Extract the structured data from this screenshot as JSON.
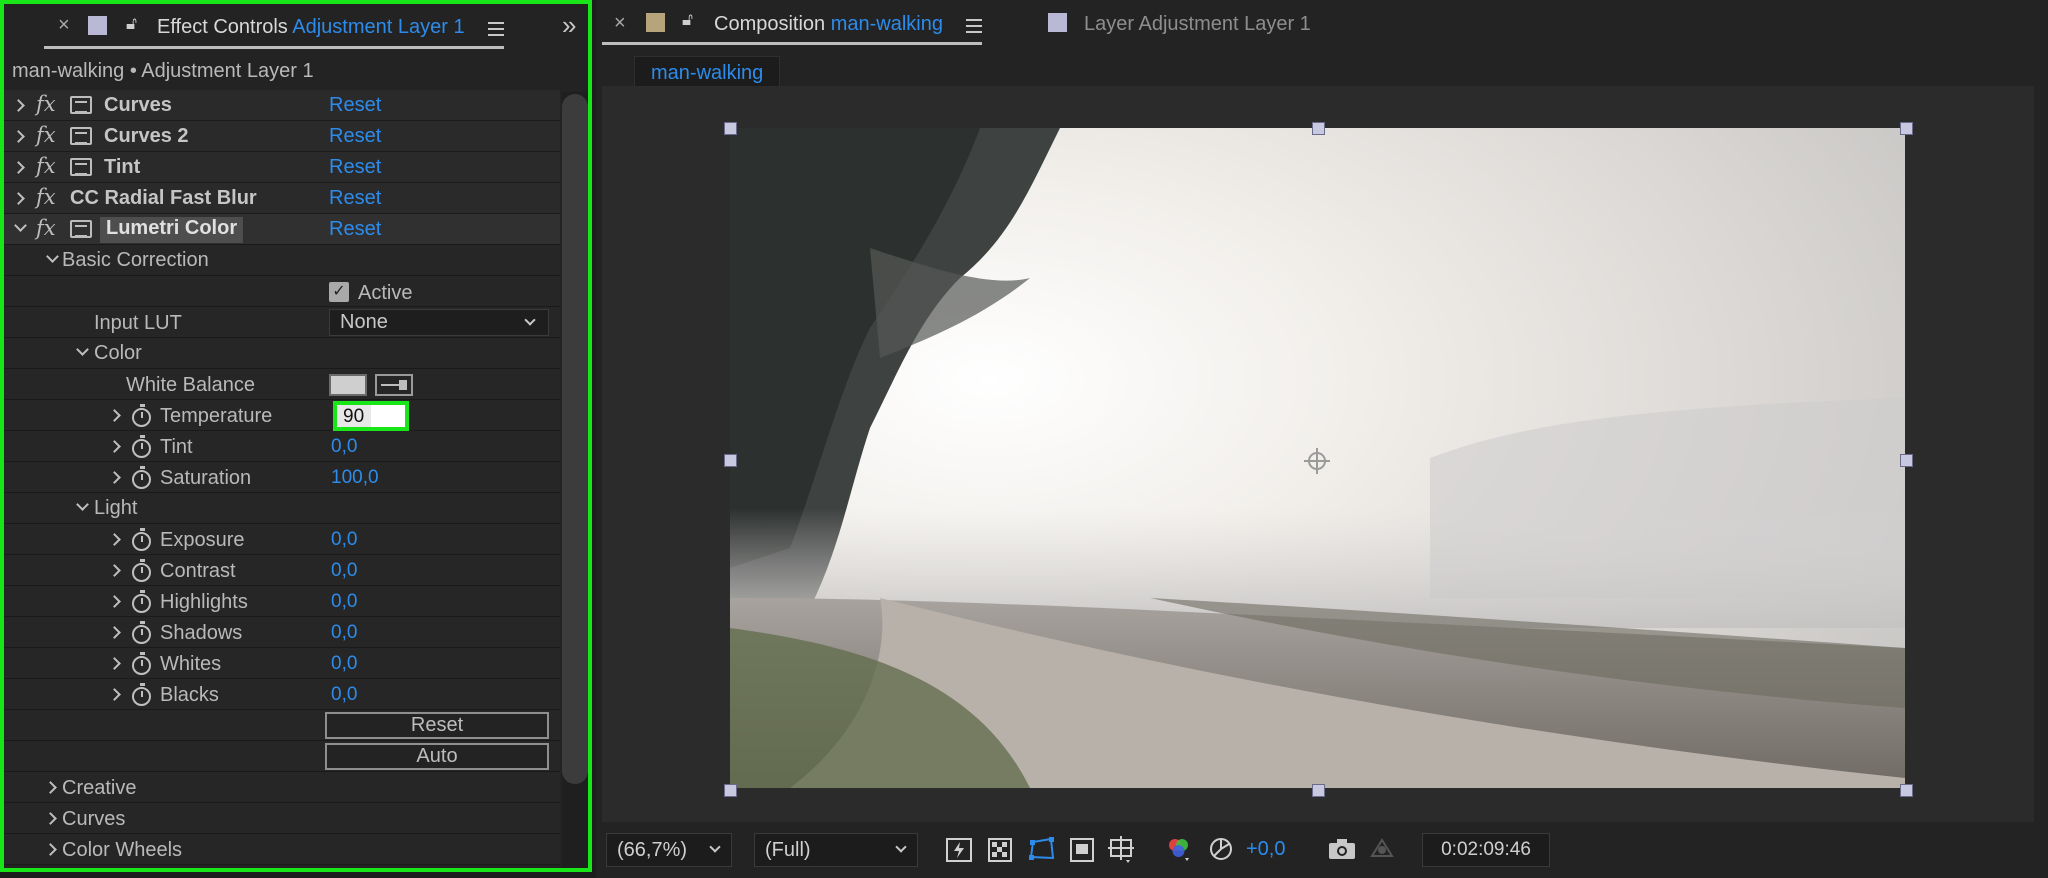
{
  "effect_controls": {
    "tab": {
      "close": "×",
      "title_prefix": "Effect Controls",
      "title_layer": "Adjustment Layer 1",
      "expand": "»"
    },
    "subtitle": "man-walking • Adjustment Layer 1",
    "effects": [
      {
        "name": "Curves",
        "reset": "Reset"
      },
      {
        "name": "Curves 2",
        "reset": "Reset"
      },
      {
        "name": "Tint",
        "reset": "Reset"
      },
      {
        "name": "CC Radial Fast Blur",
        "reset": "Reset"
      },
      {
        "name": "Lumetri Color",
        "reset": "Reset"
      }
    ],
    "basic_correction": "Basic Correction",
    "active_check": "✓",
    "active_label": "Active",
    "input_lut_label": "Input LUT",
    "input_lut_value": "None",
    "color_group": "Color",
    "white_balance_label": "White Balance",
    "temperature_label": "Temperature",
    "temperature_value": "90",
    "tint_label": "Tint",
    "tint_value": "0,0",
    "saturation_label": "Saturation",
    "saturation_value": "100,0",
    "light_group": "Light",
    "light_params": [
      {
        "label": "Exposure",
        "value": "0,0"
      },
      {
        "label": "Contrast",
        "value": "0,0"
      },
      {
        "label": "Highlights",
        "value": "0,0"
      },
      {
        "label": "Shadows",
        "value": "0,0"
      },
      {
        "label": "Whites",
        "value": "0,0"
      },
      {
        "label": "Blacks",
        "value": "0,0"
      }
    ],
    "reset_button": "Reset",
    "auto_button": "Auto",
    "sections": [
      "Creative",
      "Curves",
      "Color Wheels"
    ]
  },
  "composition": {
    "tab_close": "×",
    "tab_prefix": "Composition",
    "tab_name": "man-walking",
    "layer_tab": "Layer  Adjustment Layer 1",
    "flowchip": "man-walking",
    "zoom": "(66,7%)",
    "resolution": "(Full)",
    "exposure": "+0,0",
    "timecode": "0:02:09:46"
  },
  "colors": {
    "accent_blue": "#2d8ceb",
    "highlight_green": "#19e619",
    "label_lavender": "#b9b9d6",
    "label_tan": "#b8a47a"
  }
}
